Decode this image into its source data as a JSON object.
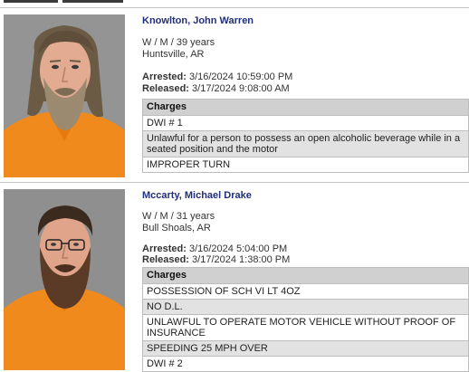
{
  "colors": {
    "name_link": "#1f2f7a",
    "charges_header_bg": "#d0d0d0",
    "row_alt_bg": "#e2e2e2",
    "jumpsuit": "#f08a1c",
    "photo_bg": "#8f8f8f"
  },
  "records": [
    {
      "name": "Knowlton, John Warren",
      "demographics": "W / M / 39 years",
      "location": "Huntsville, AR",
      "arrested_label": "Arrested:",
      "arrested": "3/16/2024 10:59:00 PM",
      "released_label": "Released:",
      "released": "3/17/2024 9:08:00 AM",
      "charges_header": "Charges",
      "charges": [
        "DWI # 1",
        "Unlawful for a person to possess an open alcoholic beverage while in a seated position and the motor",
        "IMPROPER TURN"
      ]
    },
    {
      "name": "Mccarty, Michael Drake",
      "demographics": "W / M / 31 years",
      "location": "Bull Shoals, AR",
      "arrested_label": "Arrested:",
      "arrested": "3/16/2024 5:04:00 PM",
      "released_label": "Released:",
      "released": "3/17/2024 1:38:00 PM",
      "charges_header": "Charges",
      "charges": [
        "POSSESSION OF SCH VI LT 4OZ",
        "NO D.L.",
        "UNLAWFUL TO OPERATE MOTOR VEHICLE WITHOUT PROOF OF INSURANCE",
        "SPEEDING 25 MPH OVER",
        "DWI # 2"
      ]
    }
  ]
}
